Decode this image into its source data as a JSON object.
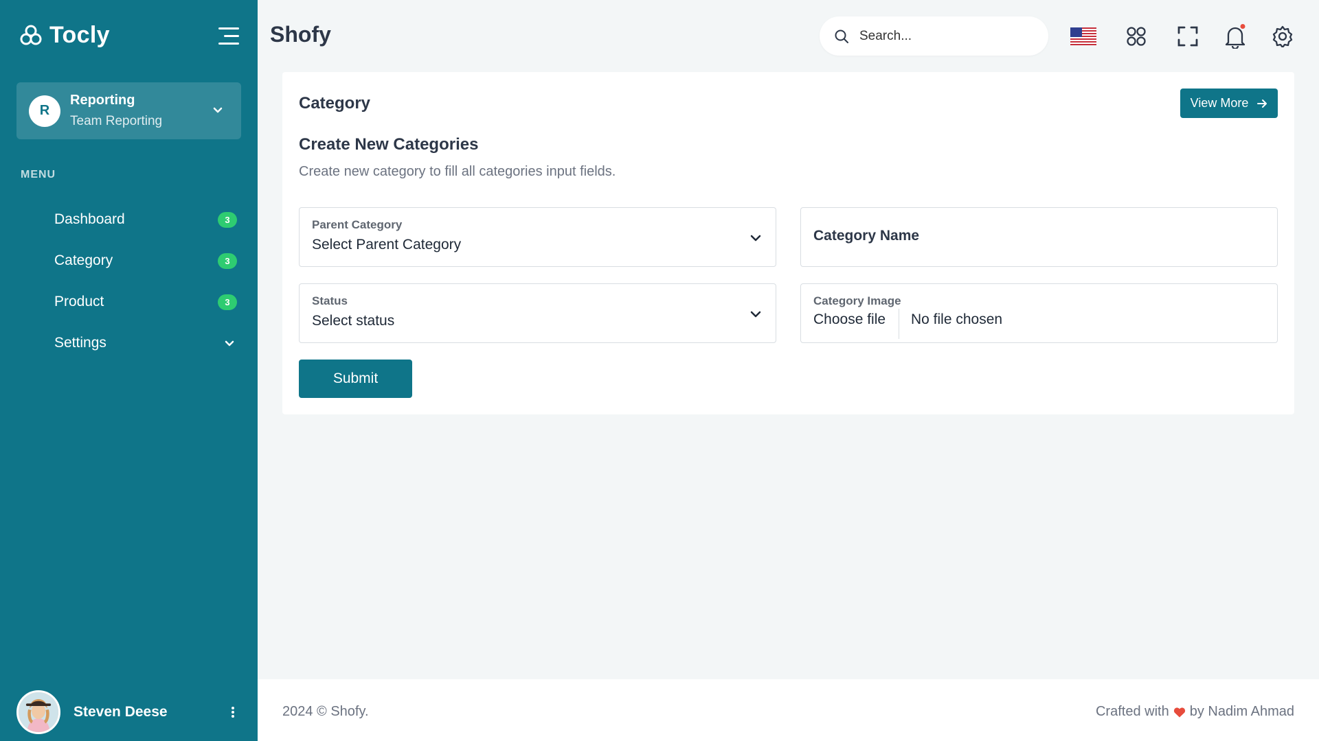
{
  "brand": {
    "name": "Tocly"
  },
  "team": {
    "initial": "R",
    "title": "Reporting",
    "subtitle": "Team Reporting"
  },
  "menu": {
    "label": "MENU",
    "items": [
      {
        "label": "Dashboard",
        "badge": "3"
      },
      {
        "label": "Category",
        "badge": "3"
      },
      {
        "label": "Product",
        "badge": "3"
      },
      {
        "label": "Settings"
      }
    ]
  },
  "user": {
    "name": "Steven Deese"
  },
  "header": {
    "title": "Shofy",
    "search_placeholder": "Search..."
  },
  "card": {
    "title": "Category",
    "view_more_label": "View More",
    "form_title": "Create New Categories",
    "form_desc": "Create new category to fill all categories input fields.",
    "parent_category": {
      "label": "Parent Category",
      "value": "Select Parent Category"
    },
    "category_name": {
      "label": "Category Name"
    },
    "status": {
      "label": "Status",
      "value": "Select status"
    },
    "category_image": {
      "label": "Category Image",
      "button": "Choose file",
      "status": "No file chosen"
    },
    "submit_label": "Submit"
  },
  "footer": {
    "left": "2024 © Shofy.",
    "right_prefix": "Crafted with",
    "right_suffix": "by Nadim Ahmad"
  },
  "colors": {
    "primary": "#0f7589",
    "badge": "#2ecc71",
    "notification_dot": "#e74c3c",
    "heart": "#e74c3c"
  }
}
